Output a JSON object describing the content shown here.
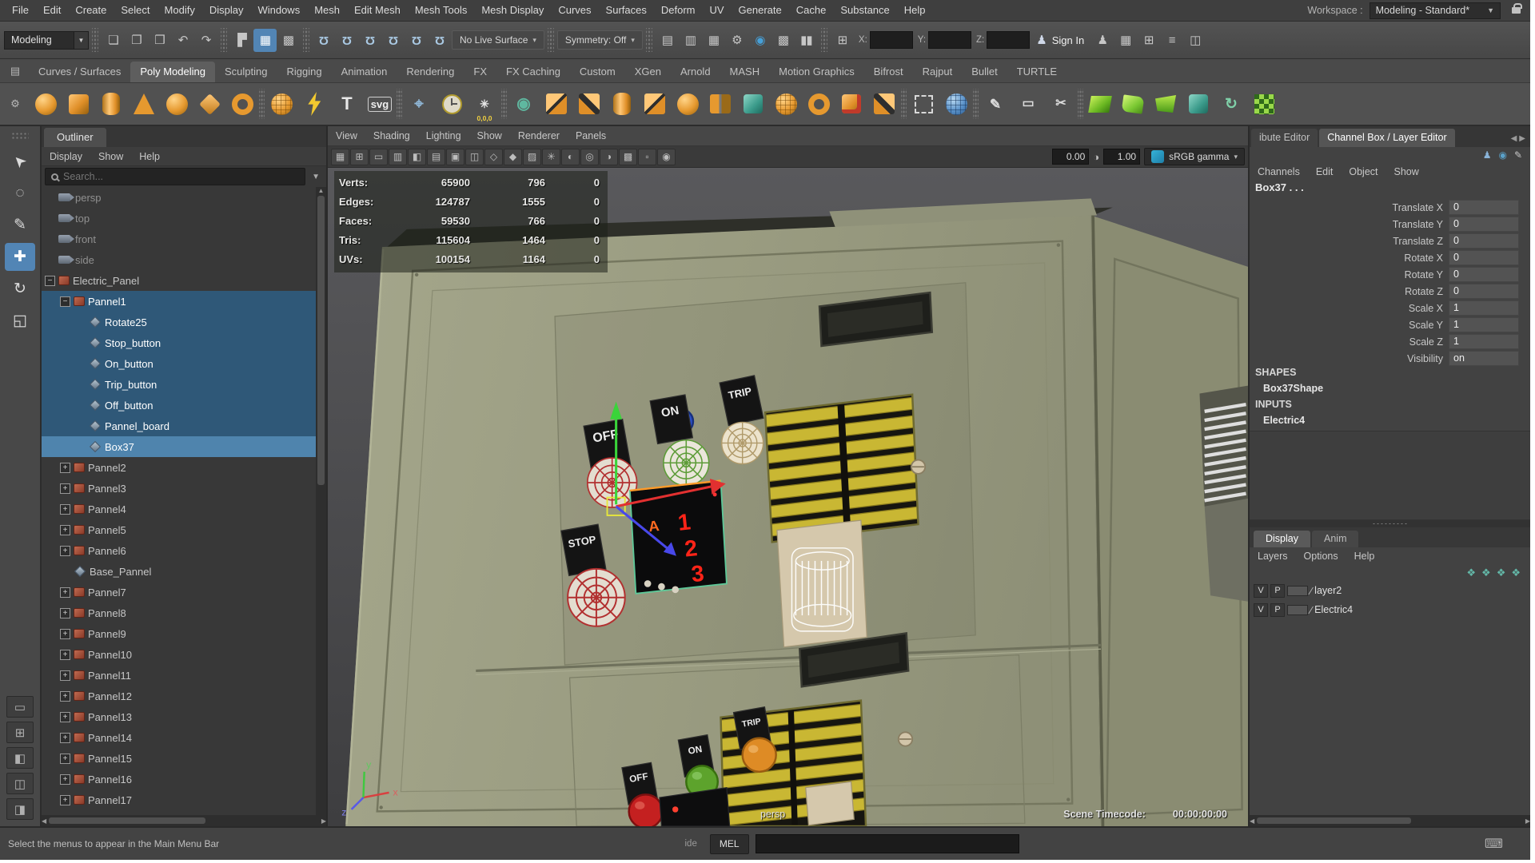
{
  "colors": {
    "accent_blue": "#5285b5",
    "selection_row": "#2f5878",
    "selection_row_bright": "#4f84ad",
    "shelf_orange": "#e6992f",
    "vent_yellow": "#c9b733",
    "cabinet_green": "#989a7f"
  },
  "menubar": {
    "items": [
      "File",
      "Edit",
      "Create",
      "Select",
      "Modify",
      "Display",
      "Windows",
      "Mesh",
      "Edit Mesh",
      "Mesh Tools",
      "Mesh Display",
      "Curves",
      "Surfaces",
      "Deform",
      "UV",
      "Generate",
      "Cache",
      "Substance",
      "Help"
    ],
    "workspace_label": "Workspace :",
    "workspace_value": "Modeling - Standard*"
  },
  "statusline": {
    "menuset": "Modeling",
    "file_icons": [
      {
        "name": "new-scene",
        "glyph": "❏"
      },
      {
        "name": "open-scene",
        "glyph": "❐"
      },
      {
        "name": "save-scene",
        "glyph": "❒"
      },
      {
        "name": "undo",
        "glyph": "↶"
      },
      {
        "name": "redo",
        "glyph": "↷"
      }
    ],
    "selection_icons": [
      {
        "name": "select-by-hierarchy",
        "glyph": "▛"
      },
      {
        "name": "select-by-object",
        "glyph": "▦",
        "active": true
      },
      {
        "name": "select-by-component",
        "glyph": "▩"
      }
    ],
    "snap_icons": [
      {
        "name": "snap-to-grid"
      },
      {
        "name": "snap-to-curve"
      },
      {
        "name": "snap-to-point"
      },
      {
        "name": "snap-to-projected-center"
      },
      {
        "name": "snap-to-view-plane"
      },
      {
        "name": "make-object-live"
      }
    ],
    "no_live_surface": "No Live Surface",
    "symmetry": "Symmetry: Off",
    "render_icons": [
      {
        "name": "open-render-view",
        "glyph": "▤"
      },
      {
        "name": "render-current-frame",
        "glyph": "▥"
      },
      {
        "name": "ipr-render",
        "glyph": "▦"
      },
      {
        "name": "render-settings",
        "glyph": "⚙"
      },
      {
        "name": "hypershade",
        "glyph": "◉",
        "color": "#46a0d8"
      },
      {
        "name": "light-editor",
        "glyph": "▩"
      },
      {
        "name": "pause-viewport",
        "glyph": "▮▮"
      }
    ],
    "coords": {
      "x_label": "X:",
      "y_label": "Y:",
      "z_label": "Z:",
      "x": "",
      "y": "",
      "z": ""
    },
    "sign_in": "Sign In",
    "trailing_icons": [
      {
        "name": "character-controls",
        "glyph": "♟"
      },
      {
        "name": "pose-editor",
        "glyph": "▦"
      },
      {
        "name": "align-tools",
        "glyph": "⊞"
      },
      {
        "name": "display-layer-toggle",
        "glyph": "≡"
      },
      {
        "name": "workspace-panels",
        "glyph": "◫"
      }
    ]
  },
  "shelf": {
    "left_buttons": [
      {
        "name": "shelf-menu",
        "glyph": "▤"
      },
      {
        "name": "shelf-options",
        "glyph": "⚙"
      }
    ],
    "tabs": [
      "Curves / Surfaces",
      "Poly Modeling",
      "Sculpting",
      "Rigging",
      "Animation",
      "Rendering",
      "FX",
      "FX Caching",
      "Custom",
      "XGen",
      "Arnold",
      "MASH",
      "Motion Graphics",
      "Bifrost",
      "Rajput",
      "Bullet",
      "TURTLE"
    ],
    "active_tab": "Poly Modeling",
    "icons": [
      {
        "name": "poly-sphere",
        "shape": "sphere"
      },
      {
        "name": "poly-cube",
        "shape": "cube"
      },
      {
        "name": "poly-cylinder",
        "shape": "cyl"
      },
      {
        "name": "poly-cone",
        "shape": "cone"
      },
      {
        "name": "poly-ball",
        "shape": "sphere"
      },
      {
        "name": "poly-pyramid",
        "shape": "diamond"
      },
      {
        "name": "poly-torus",
        "shape": "ring"
      },
      {
        "sep": true
      },
      {
        "name": "platonic-solid",
        "shape": "spherewire"
      },
      {
        "name": "create-polygon-tool",
        "shape": "bolt"
      },
      {
        "name": "type-tool",
        "shape": "glyph",
        "glyph": "T",
        "fg": "#e8e8e8",
        "size": 22
      },
      {
        "name": "svg-tool",
        "shape": "glyph",
        "glyph": "svg",
        "fg": "#f0f0f0",
        "size": 13,
        "box": true
      },
      {
        "sep": true
      },
      {
        "name": "construction-plane",
        "shape": "glyph",
        "glyph": "⌖",
        "fg": "#8fb6d6",
        "size": 20
      },
      {
        "name": "reset-transform-clock",
        "shape": "clock"
      },
      {
        "name": "snap-to-origin",
        "shape": "glyph",
        "glyph": "✳",
        "fg": "#e8e8e8",
        "size": 14,
        "label": "0,0,0"
      },
      {
        "sep": true
      },
      {
        "name": "combine-meshes",
        "shape": "glyph",
        "glyph": "◉",
        "fg": "#5fb8a0",
        "size": 20
      },
      {
        "name": "boolean-union",
        "shape": "blocks"
      },
      {
        "name": "boolean-difference",
        "shape": "blocks2"
      },
      {
        "name": "extrude-faces",
        "shape": "cyl"
      },
      {
        "name": "bridge-edges",
        "shape": "blocks"
      },
      {
        "name": "smooth-mesh",
        "shape": "sphere"
      },
      {
        "name": "mirror-geometry",
        "shape": "mirror"
      },
      {
        "name": "subdiv-proxy",
        "shape": "cubeteal"
      },
      {
        "name": "reduce-mesh",
        "shape": "spherewire"
      },
      {
        "name": "multi-cut-tool",
        "shape": "ring"
      },
      {
        "name": "quad-draw-tool",
        "shape": "cubered"
      },
      {
        "name": "connect-components",
        "shape": "blocks2"
      },
      {
        "sep": true
      },
      {
        "name": "marquee-select",
        "shape": "dashed"
      },
      {
        "name": "uv-sphere-project",
        "shape": "sphereblue"
      },
      {
        "sep": true
      },
      {
        "name": "crease-set-editor",
        "shape": "glyph",
        "glyph": "✎",
        "fg": "#dcdcdc",
        "size": 17
      },
      {
        "name": "edit-edge-flow",
        "shape": "glyph",
        "glyph": "▭",
        "fg": "#dcdcdc",
        "size": 16
      },
      {
        "name": "cut-faces-tool",
        "shape": "glyph",
        "glyph": "✂",
        "fg": "#dcdcdc",
        "size": 16
      },
      {
        "sep": true
      },
      {
        "name": "quad-patch",
        "shape": "quadgreen"
      },
      {
        "name": "surface-patch",
        "shape": "quadgreen2"
      },
      {
        "name": "boundary-fill",
        "shape": "quadgreen3"
      },
      {
        "name": "uv-cube",
        "shape": "cubeteal"
      },
      {
        "name": "revolve-spiral",
        "shape": "glyph",
        "glyph": "↻",
        "fg": "#7fd0a8",
        "size": 19
      },
      {
        "name": "checker-pattern",
        "shape": "checker"
      }
    ]
  },
  "toolbox": {
    "tools": [
      {
        "name": "select-tool",
        "glyph": "➤",
        "rot": true
      },
      {
        "name": "lasso-tool",
        "glyph": "◌"
      },
      {
        "name": "paint-select-tool",
        "glyph": "✎"
      },
      {
        "name": "move-tool",
        "glyph": "✚",
        "active": true
      },
      {
        "name": "rotate-tool",
        "glyph": "↻"
      },
      {
        "name": "scale-tool",
        "glyph": "◱"
      }
    ],
    "layouts": [
      {
        "name": "layout-single-pane",
        "glyph": "▭"
      },
      {
        "name": "layout-four-pane",
        "glyph": "⊞"
      },
      {
        "name": "layout-persp-outliner",
        "glyph": "◧"
      },
      {
        "name": "layout-hypershade-persp",
        "glyph": "◫"
      },
      {
        "name": "layout-animation",
        "glyph": "◨"
      }
    ]
  },
  "outliner": {
    "title": "Outliner",
    "menus": [
      "Display",
      "Show",
      "Help"
    ],
    "search_placeholder": "Search...",
    "rows": [
      {
        "label": "persp",
        "indent": 1,
        "icon": "camera",
        "exp": "none"
      },
      {
        "label": "top",
        "indent": 1,
        "icon": "camera",
        "exp": "none"
      },
      {
        "label": "front",
        "indent": 1,
        "icon": "camera",
        "exp": "none"
      },
      {
        "label": "side",
        "indent": 1,
        "icon": "camera",
        "exp": "none"
      },
      {
        "label": "Electric_Panel",
        "indent": 1,
        "icon": "group",
        "exp": "minus"
      },
      {
        "label": "Pannel1",
        "indent": 2,
        "icon": "group",
        "exp": "minus",
        "sel": "sel"
      },
      {
        "label": "Rotate25",
        "indent": 3,
        "icon": "mesh",
        "exp": "none",
        "sel": "sel"
      },
      {
        "label": "Stop_button",
        "indent": 3,
        "icon": "mesh",
        "exp": "none",
        "sel": "sel"
      },
      {
        "label": "On_button",
        "indent": 3,
        "icon": "mesh",
        "exp": "none",
        "sel": "sel"
      },
      {
        "label": "Trip_button",
        "indent": 3,
        "icon": "mesh",
        "exp": "none",
        "sel": "sel"
      },
      {
        "label": "Off_button",
        "indent": 3,
        "icon": "mesh",
        "exp": "none",
        "sel": "sel"
      },
      {
        "label": "Pannel_board",
        "indent": 3,
        "icon": "mesh",
        "exp": "none",
        "sel": "sel"
      },
      {
        "label": "Box37",
        "indent": 3,
        "icon": "mesh",
        "exp": "none",
        "sel": "selb"
      },
      {
        "label": "Pannel2",
        "indent": 2,
        "icon": "group",
        "exp": "plus"
      },
      {
        "label": "Pannel3",
        "indent": 2,
        "icon": "group",
        "exp": "plus"
      },
      {
        "label": "Pannel4",
        "indent": 2,
        "icon": "group",
        "exp": "plus"
      },
      {
        "label": "Pannel5",
        "indent": 2,
        "icon": "group",
        "exp": "plus"
      },
      {
        "label": "Pannel6",
        "indent": 2,
        "icon": "group",
        "exp": "plus"
      },
      {
        "label": "Base_Pannel",
        "indent": 2,
        "icon": "mesh",
        "exp": "none"
      },
      {
        "label": "Pannel7",
        "indent": 2,
        "icon": "group",
        "exp": "plus"
      },
      {
        "label": "Pannel8",
        "indent": 2,
        "icon": "group",
        "exp": "plus"
      },
      {
        "label": "Pannel9",
        "indent": 2,
        "icon": "group",
        "exp": "plus"
      },
      {
        "label": "Pannel10",
        "indent": 2,
        "icon": "group",
        "exp": "plus"
      },
      {
        "label": "Pannel11",
        "indent": 2,
        "icon": "group",
        "exp": "plus"
      },
      {
        "label": "Pannel12",
        "indent": 2,
        "icon": "group",
        "exp": "plus"
      },
      {
        "label": "Pannel13",
        "indent": 2,
        "icon": "group",
        "exp": "plus"
      },
      {
        "label": "Pannel14",
        "indent": 2,
        "icon": "group",
        "exp": "plus"
      },
      {
        "label": "Pannel15",
        "indent": 2,
        "icon": "group",
        "exp": "plus"
      },
      {
        "label": "Pannel16",
        "indent": 2,
        "icon": "group",
        "exp": "plus"
      },
      {
        "label": "Pannel17",
        "indent": 2,
        "icon": "group",
        "exp": "plus"
      }
    ]
  },
  "viewport": {
    "menus": [
      "View",
      "Shading",
      "Lighting",
      "Show",
      "Renderer",
      "Panels"
    ],
    "toolbar_icons": [
      {
        "name": "select-camera",
        "glyph": "▦"
      },
      {
        "name": "grid-toggle",
        "glyph": "⊞"
      },
      {
        "name": "film-gate",
        "glyph": "▭"
      },
      {
        "name": "resolution-gate",
        "glyph": "▥"
      },
      {
        "name": "gate-mask",
        "glyph": "◧"
      },
      {
        "name": "field-chart",
        "glyph": "▤"
      },
      {
        "name": "safe-action",
        "glyph": "▣"
      },
      {
        "name": "safe-title",
        "glyph": "◫"
      },
      {
        "name": "wireframe-mode",
        "glyph": "◇"
      },
      {
        "name": "shaded-mode",
        "glyph": "◆"
      },
      {
        "name": "textured-mode",
        "glyph": "▨"
      },
      {
        "name": "use-all-lights",
        "glyph": "✳"
      },
      {
        "name": "shadows-toggle",
        "glyph": "◐"
      },
      {
        "name": "screen-space-ao",
        "glyph": "◎"
      },
      {
        "name": "motion-blur",
        "glyph": "◑"
      },
      {
        "name": "anti-aliasing",
        "glyph": "▩"
      },
      {
        "name": "xray-mode",
        "glyph": "▫"
      },
      {
        "name": "isolate-select",
        "glyph": "◉"
      }
    ],
    "exposure": "0.00",
    "gamma": "1.00",
    "colorspace": "sRGB gamma",
    "hud": {
      "rows": [
        {
          "label": "Verts:",
          "v1": "65900",
          "v2": "796",
          "v3": "0"
        },
        {
          "label": "Edges:",
          "v1": "124787",
          "v2": "1555",
          "v3": "0"
        },
        {
          "label": "Faces:",
          "v1": "59530",
          "v2": "766",
          "v3": "0"
        },
        {
          "label": "Tris:",
          "v1": "115604",
          "v2": "1464",
          "v3": "0"
        },
        {
          "label": "UVs:",
          "v1": "100154",
          "v2": "1164",
          "v3": "0"
        }
      ]
    },
    "camera_label": "persp",
    "timecode_label": "Scene Timecode:",
    "timecode_value": "00:00:00:00",
    "scene": {
      "off_upper": "OFF",
      "on_upper": "ON",
      "trip_upper": "TRIP",
      "stop": "STOP",
      "off_lower": "OFF",
      "on_lower": "ON",
      "trip_lower": "TRIP",
      "display_letter": "A",
      "digit1": "1",
      "digit2": "2",
      "digit3": "3",
      "axis": {
        "x": "x",
        "y": "y",
        "z": "z"
      }
    }
  },
  "channelbox": {
    "tab_partial": "ibute Editor",
    "tab_active": "Channel Box / Layer Editor",
    "toolbar_icons": [
      {
        "name": "channels-speed",
        "glyph": "♟",
        "color": "#8ab4d8"
      },
      {
        "name": "channels-hyperbolic",
        "glyph": "◉",
        "color": "#5aa0c8"
      },
      {
        "name": "channels-precision",
        "glyph": "✎",
        "color": "#c8c8c8"
      }
    ],
    "menus": [
      "Channels",
      "Edit",
      "Object",
      "Show"
    ],
    "object_name": "Box37 . . .",
    "rows": [
      {
        "label": "Translate X",
        "value": "0"
      },
      {
        "label": "Translate Y",
        "value": "0"
      },
      {
        "label": "Translate Z",
        "value": "0"
      },
      {
        "label": "Rotate X",
        "value": "0"
      },
      {
        "label": "Rotate Y",
        "value": "0"
      },
      {
        "label": "Rotate Z",
        "value": "0"
      },
      {
        "label": "Scale X",
        "value": "1"
      },
      {
        "label": "Scale Y",
        "value": "1"
      },
      {
        "label": "Scale Z",
        "value": "1"
      },
      {
        "label": "Visibility",
        "value": "on"
      }
    ],
    "shapes_header": "SHAPES",
    "shape_name": "Box37Shape",
    "inputs_header": "INPUTS",
    "input_name": "Electric4"
  },
  "layers": {
    "tabs": [
      {
        "label": "Display",
        "active": true
      },
      {
        "label": "Anim",
        "active": false
      }
    ],
    "menus": [
      "Layers",
      "Options",
      "Help"
    ],
    "toolbar_icons": [
      {
        "name": "move-layer-up"
      },
      {
        "name": "move-layer-down"
      },
      {
        "name": "create-empty-layer"
      },
      {
        "name": "create-layer-from-selected"
      }
    ],
    "rows": [
      {
        "v": "V",
        "p": "P",
        "name": "layer2"
      },
      {
        "v": "V",
        "p": "P",
        "name": "Electric4"
      }
    ]
  },
  "statusbar": {
    "help_text": "Select the menus to appear in the Main Menu Bar",
    "partial_text": "ide",
    "mel_label": "MEL",
    "command_value": ""
  }
}
